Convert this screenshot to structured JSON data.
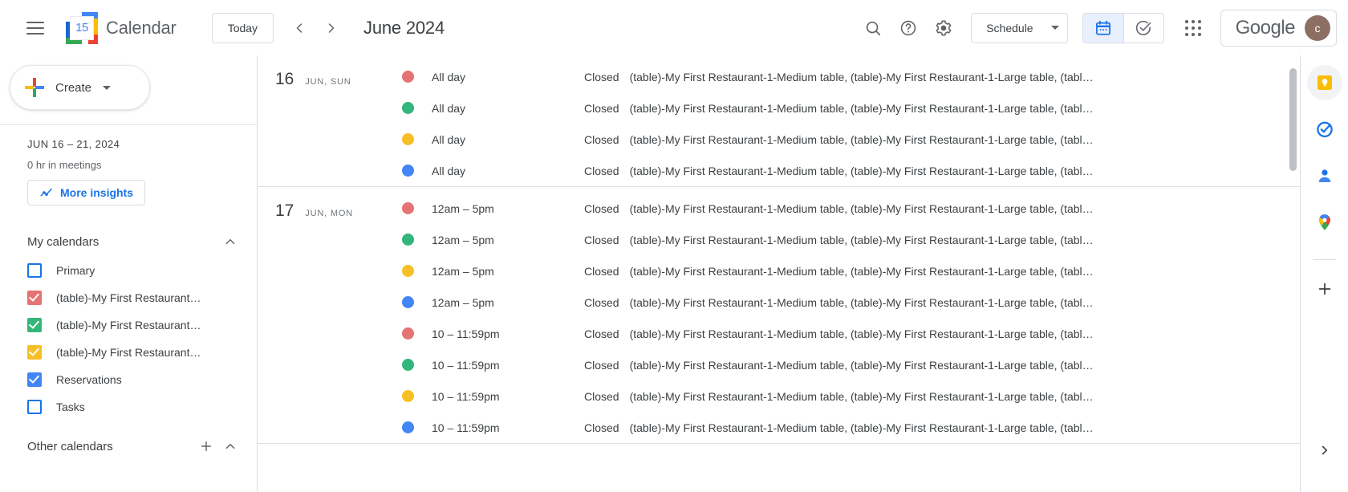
{
  "header": {
    "menu_icon": "hamburger-icon",
    "logo_day": "15",
    "app_title": "Calendar",
    "today_label": "Today",
    "prev_icon": "chevron-left-icon",
    "next_icon": "chevron-right-icon",
    "period_title": "June 2024",
    "search_icon": "search-icon",
    "help_icon": "help-icon",
    "settings_icon": "gear-icon",
    "view_label": "Schedule",
    "calendar_toggle_icon": "calendar-icon",
    "tasks_toggle_icon": "check-circle-icon",
    "apps_icon": "apps-grid-icon",
    "google_word": "Google",
    "avatar_initial": "c"
  },
  "sidebar": {
    "create_label": "Create",
    "create_plus_icon": "plus-icon",
    "create_caret_icon": "chevron-down-icon",
    "insights_range": "JUN 16 – 21, 2024",
    "insights_meetings": "0 hr in meetings",
    "insights_button": "More insights",
    "insights_icon": "insights-chart-icon",
    "my_calendars_title": "My calendars",
    "my_calendars_collapse_icon": "chevron-up-icon",
    "calendars": [
      {
        "label": "Primary",
        "checked": false,
        "color": "#1a73e8"
      },
      {
        "label": "(table)-My First Restaurant…",
        "checked": true,
        "color": "#e57373"
      },
      {
        "label": "(table)-My First Restaurant…",
        "checked": true,
        "color": "#33b679"
      },
      {
        "label": "(table)-My First Restaurant…",
        "checked": true,
        "color": "#f6bf26"
      },
      {
        "label": "Reservations",
        "checked": true,
        "color": "#4285f4"
      },
      {
        "label": "Tasks",
        "checked": false,
        "color": "#1a73e8"
      }
    ],
    "other_calendars_title": "Other calendars",
    "other_add_icon": "plus-icon",
    "other_collapse_icon": "chevron-up-icon"
  },
  "schedule": {
    "event_description": "(table)-My First Restaurant-1-Medium table, (table)-My First Restaurant-1-Large table, (tabl…",
    "days": [
      {
        "day_number": "16",
        "day_label": "JUN, SUN",
        "events": [
          {
            "color": "#e57373",
            "time": "All day",
            "title": "Closed"
          },
          {
            "color": "#33b679",
            "time": "All day",
            "title": "Closed"
          },
          {
            "color": "#f6bf26",
            "time": "All day",
            "title": "Closed"
          },
          {
            "color": "#4285f4",
            "time": "All day",
            "title": "Closed"
          }
        ]
      },
      {
        "day_number": "17",
        "day_label": "JUN, MON",
        "events": [
          {
            "color": "#e57373",
            "time": "12am – 5pm",
            "title": "Closed"
          },
          {
            "color": "#33b679",
            "time": "12am – 5pm",
            "title": "Closed"
          },
          {
            "color": "#f6bf26",
            "time": "12am – 5pm",
            "title": "Closed"
          },
          {
            "color": "#4285f4",
            "time": "12am – 5pm",
            "title": "Closed"
          },
          {
            "color": "#e57373",
            "time": "10 – 11:59pm",
            "title": "Closed"
          },
          {
            "color": "#33b679",
            "time": "10 – 11:59pm",
            "title": "Closed"
          },
          {
            "color": "#f6bf26",
            "time": "10 – 11:59pm",
            "title": "Closed"
          },
          {
            "color": "#4285f4",
            "time": "10 – 11:59pm",
            "title": "Closed"
          }
        ]
      }
    ]
  },
  "right_rail": {
    "items": [
      {
        "icon": "google-keep-icon",
        "selected": true
      },
      {
        "icon": "google-tasks-icon",
        "selected": false
      },
      {
        "icon": "google-contacts-icon",
        "selected": false
      },
      {
        "icon": "google-maps-icon",
        "selected": false
      }
    ],
    "add_icon": "plus-icon",
    "expand_icon": "chevron-right-icon"
  }
}
